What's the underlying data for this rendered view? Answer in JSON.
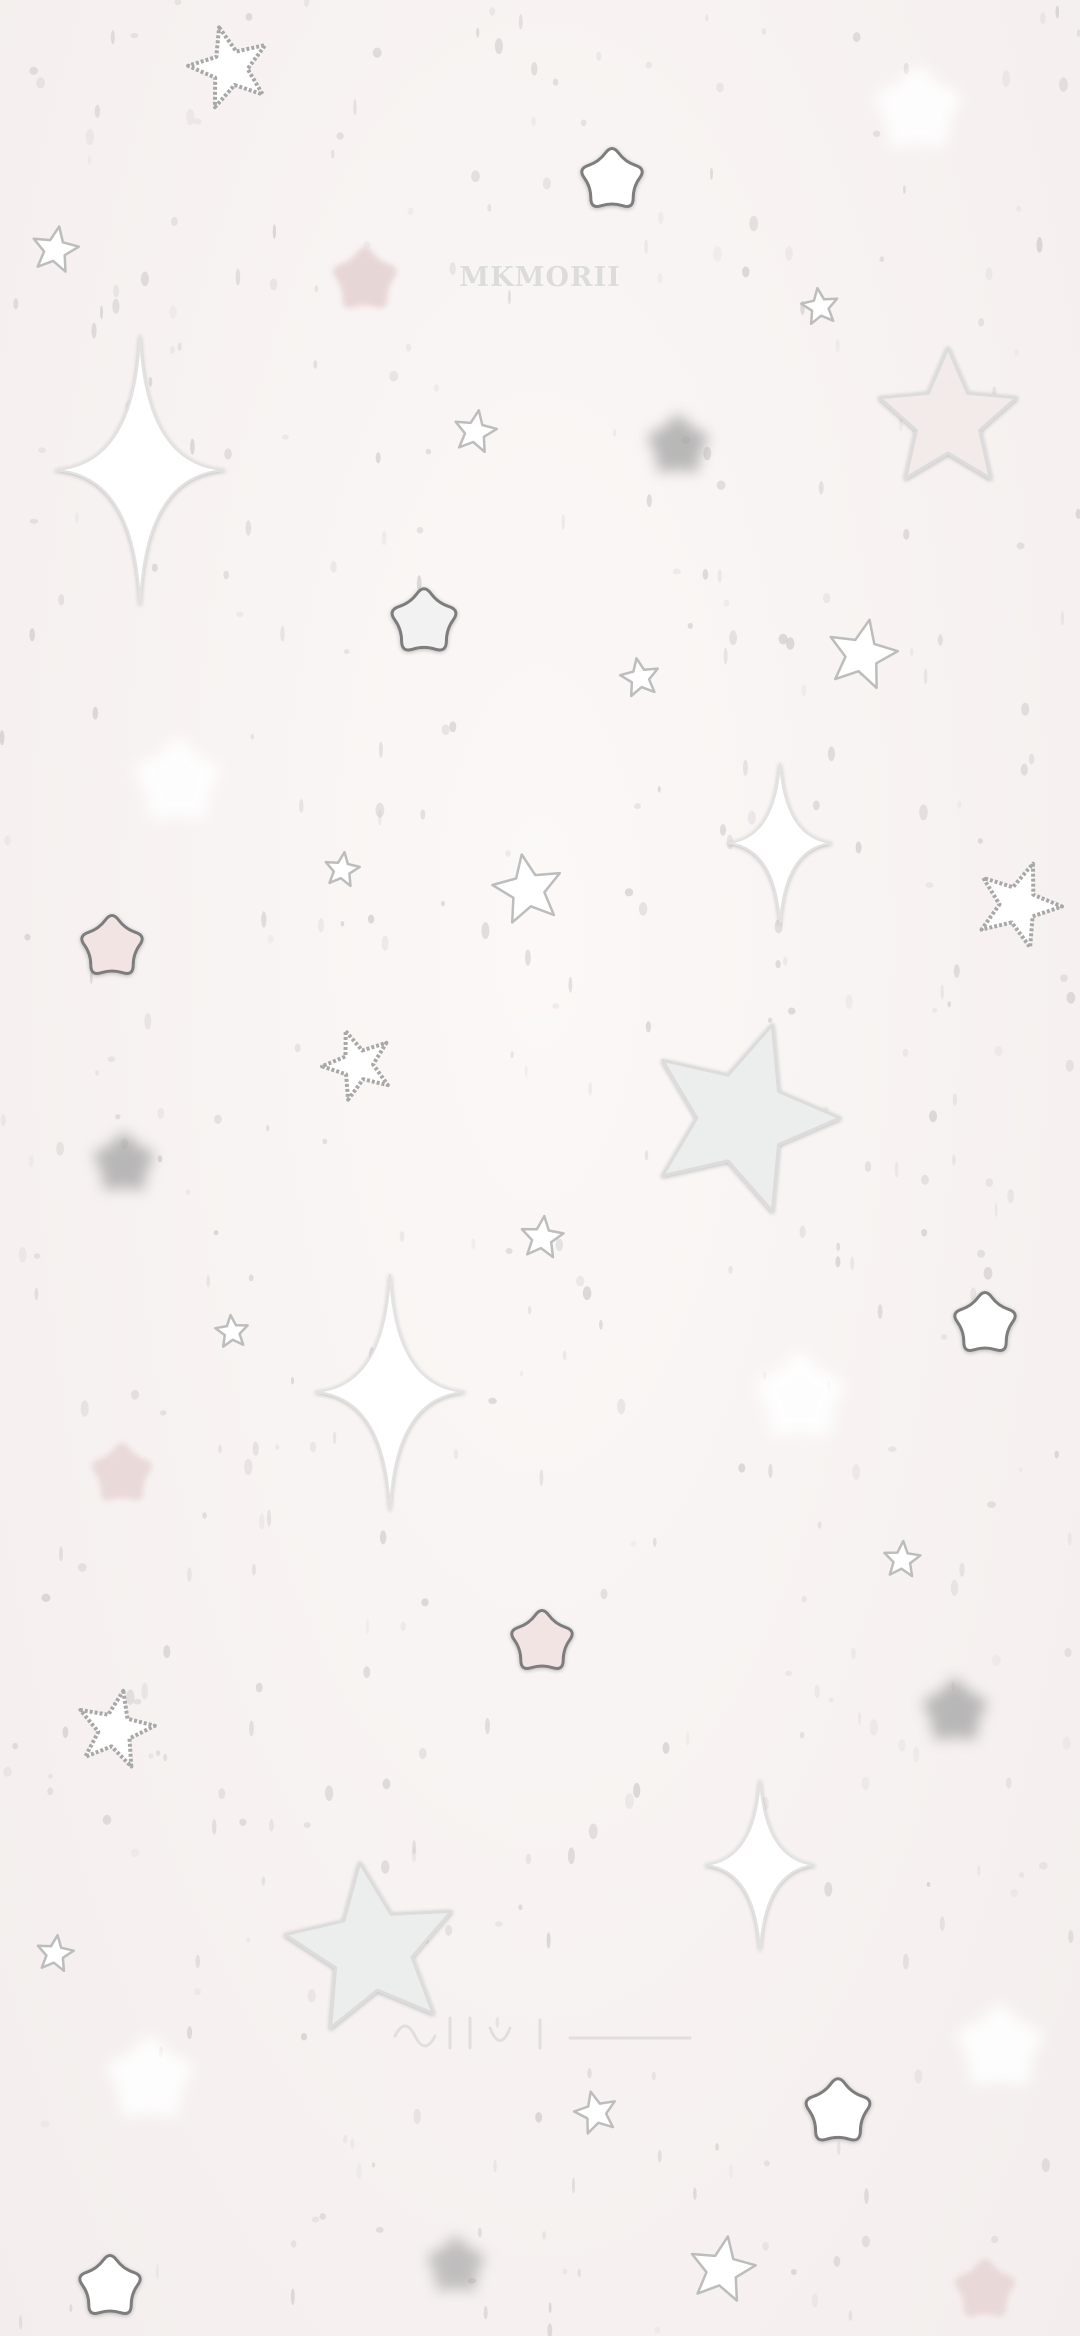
{
  "wallpaper": {
    "watermark": "MKMORII",
    "palette": {
      "background": "#f8f4f3",
      "star_fill_white": "#ffffff",
      "star_fill_pink": "#f3e4e4",
      "star_fill_grey": "#eeeeee",
      "star_outline": "#7d7d7d",
      "glitter_outline": "#a8a8a8",
      "blur_grey": "#a9a9a9",
      "speckle": "#c9c4c3"
    },
    "icons": [
      "puffy-star-icon",
      "outlined-star-icon",
      "glitter-star-icon",
      "sparkle-icon",
      "blurred-star-icon"
    ]
  }
}
